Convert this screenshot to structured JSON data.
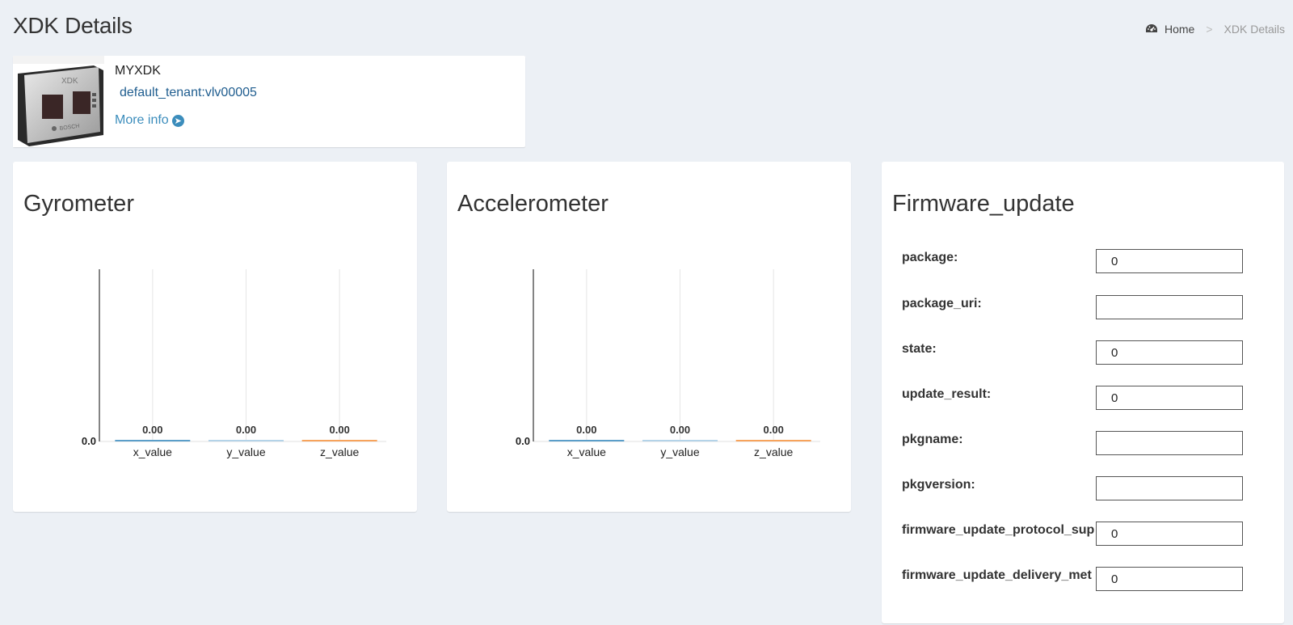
{
  "page": {
    "title": "XDK Details"
  },
  "breadcrumb": {
    "home": "Home",
    "separator": ">",
    "current": "XDK Details"
  },
  "device": {
    "name": "MYXDK",
    "tenant": "default_tenant:vlv00005",
    "more_info": "More info",
    "image_brand": "XDK",
    "image_maker": "BOSCH"
  },
  "gyrometer": {
    "title": "Gyrometer",
    "chart_data": {
      "type": "bar",
      "categories": [
        "x_value",
        "y_value",
        "z_value"
      ],
      "values": [
        0,
        0,
        0
      ],
      "data_labels": [
        "0.00",
        "0.00",
        "0.00"
      ],
      "y_tick_labels": [
        "0.0"
      ],
      "colors": [
        "#5b9ec9",
        "#b4d3e8",
        "#f7a35c"
      ],
      "grid": true
    }
  },
  "accelerometer": {
    "title": "Accelerometer",
    "chart_data": {
      "type": "bar",
      "categories": [
        "x_value",
        "y_value",
        "z_value"
      ],
      "values": [
        0,
        0,
        0
      ],
      "data_labels": [
        "0.00",
        "0.00",
        "0.00"
      ],
      "y_tick_labels": [
        "0.0"
      ],
      "colors": [
        "#5b9ec9",
        "#b4d3e8",
        "#f7a35c"
      ],
      "grid": true
    }
  },
  "firmware": {
    "title": "Firmware_update",
    "fields": [
      {
        "label": "package:",
        "value": "0"
      },
      {
        "label": "package_uri:",
        "value": ""
      },
      {
        "label": "state:",
        "value": "0"
      },
      {
        "label": "update_result:",
        "value": "0"
      },
      {
        "label": "pkgname:",
        "value": ""
      },
      {
        "label": "pkgversion:",
        "value": ""
      },
      {
        "label": "firmware_update_protocol_sup",
        "value": "0"
      },
      {
        "label": "firmware_update_delivery_met",
        "value": "0"
      }
    ]
  }
}
